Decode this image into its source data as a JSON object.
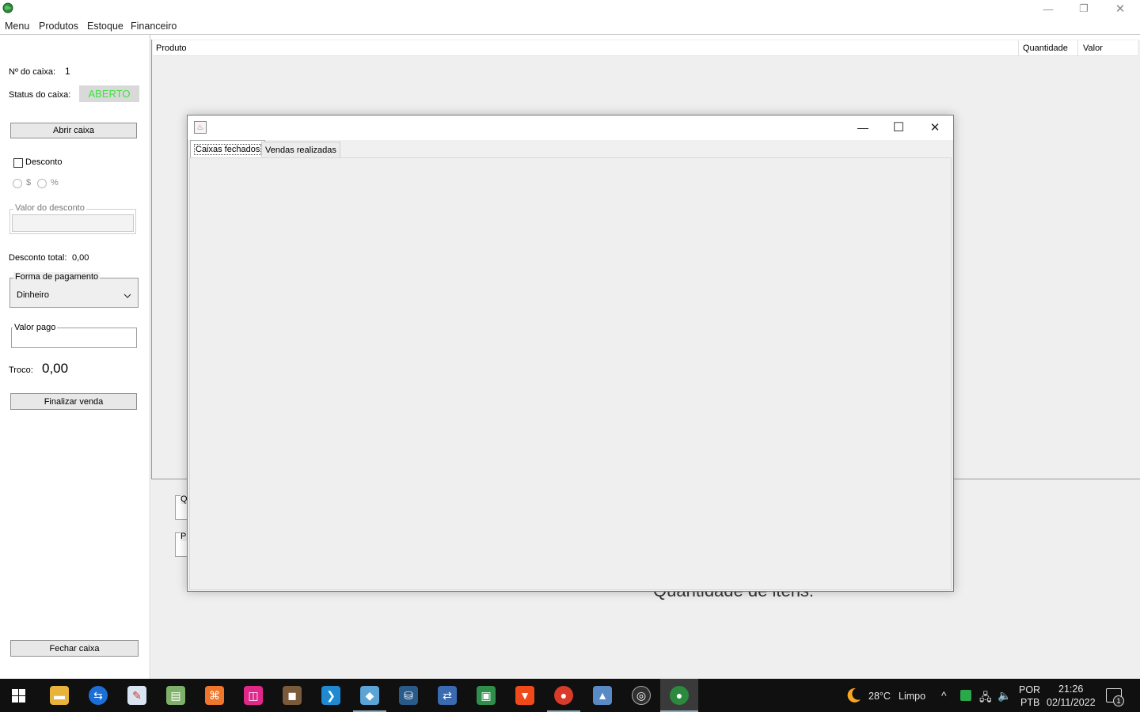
{
  "window": {
    "icon": "globe-icon",
    "minimize_glyph": "—",
    "restore_glyph": "❐",
    "close_glyph": "✕"
  },
  "menubar": {
    "items": [
      "Menu",
      "Produtos",
      "Estoque",
      "Financeiro"
    ]
  },
  "left_panel": {
    "caixa_number_label": "Nº do caixa:",
    "caixa_number_value": "1",
    "status_label": "Status do caixa:",
    "status_value": "ABERTO",
    "status_color": "#3ce23c",
    "abrir_caixa_label": "Abrir caixa",
    "desconto_label": "Desconto",
    "desconto_checked": false,
    "radio_dollar_label": "$",
    "radio_percent_label": "%",
    "valor_desconto_legend": "Valor do desconto",
    "valor_desconto_value": "",
    "desconto_total_label": "Desconto total:",
    "desconto_total_value": "0,00",
    "forma_pagamento_legend": "Forma de pagamento",
    "forma_pagamento_selected": "Dinheiro",
    "valor_pago_legend": "Valor pago",
    "valor_pago_value": "",
    "troco_label": "Troco:",
    "troco_value": "0,00",
    "finalizar_venda_label": "Finalizar venda",
    "fechar_caixa_label": "Fechar caixa"
  },
  "table": {
    "columns": [
      "Produto",
      "Quantidade",
      "Valor"
    ],
    "rows": []
  },
  "bottom": {
    "partial_label_1": "Q",
    "partial_label_2": "Pr",
    "quantidade_itens_text": "Quantidade de itens:"
  },
  "dialog": {
    "icon": "java-cup-icon",
    "minimize_glyph": "—",
    "maximize_glyph": "☐",
    "close_glyph": "✕",
    "tabs": [
      {
        "label": "Caixas fechados",
        "active": true
      },
      {
        "label": "Vendas realizadas",
        "active": false
      }
    ]
  },
  "taskbar": {
    "apps": [
      "windows-start-icon",
      "file-explorer-icon",
      "teamviewer-icon",
      "paint-icon",
      "notepad-plus-icon",
      "xampp-icon",
      "app-icon",
      "minecraft-icon",
      "vscode-icon",
      "netbeans-icon",
      "mysql-workbench-icon",
      "network-app-icon",
      "store-app-icon",
      "brave-icon",
      "chrome-icon",
      "photos-icon",
      "obs-icon",
      "java-app-icon"
    ],
    "weather_temp": "28°C",
    "weather_desc": "Limpo",
    "lang_top": "POR",
    "lang_bottom": "PTB",
    "time": "21:26",
    "date": "02/11/2022",
    "notification_count": "1"
  }
}
